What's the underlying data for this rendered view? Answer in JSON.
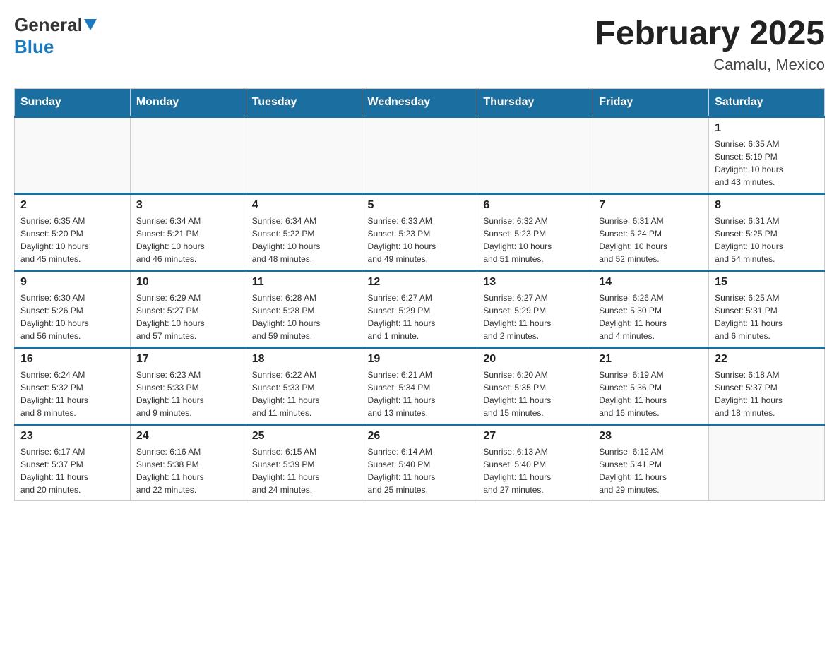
{
  "header": {
    "logo": {
      "general": "General",
      "blue": "Blue"
    },
    "title": "February 2025",
    "location": "Camalu, Mexico"
  },
  "days_of_week": [
    "Sunday",
    "Monday",
    "Tuesday",
    "Wednesday",
    "Thursday",
    "Friday",
    "Saturday"
  ],
  "weeks": [
    [
      {
        "day": "",
        "info": ""
      },
      {
        "day": "",
        "info": ""
      },
      {
        "day": "",
        "info": ""
      },
      {
        "day": "",
        "info": ""
      },
      {
        "day": "",
        "info": ""
      },
      {
        "day": "",
        "info": ""
      },
      {
        "day": "1",
        "info": "Sunrise: 6:35 AM\nSunset: 5:19 PM\nDaylight: 10 hours\nand 43 minutes."
      }
    ],
    [
      {
        "day": "2",
        "info": "Sunrise: 6:35 AM\nSunset: 5:20 PM\nDaylight: 10 hours\nand 45 minutes."
      },
      {
        "day": "3",
        "info": "Sunrise: 6:34 AM\nSunset: 5:21 PM\nDaylight: 10 hours\nand 46 minutes."
      },
      {
        "day": "4",
        "info": "Sunrise: 6:34 AM\nSunset: 5:22 PM\nDaylight: 10 hours\nand 48 minutes."
      },
      {
        "day": "5",
        "info": "Sunrise: 6:33 AM\nSunset: 5:23 PM\nDaylight: 10 hours\nand 49 minutes."
      },
      {
        "day": "6",
        "info": "Sunrise: 6:32 AM\nSunset: 5:23 PM\nDaylight: 10 hours\nand 51 minutes."
      },
      {
        "day": "7",
        "info": "Sunrise: 6:31 AM\nSunset: 5:24 PM\nDaylight: 10 hours\nand 52 minutes."
      },
      {
        "day": "8",
        "info": "Sunrise: 6:31 AM\nSunset: 5:25 PM\nDaylight: 10 hours\nand 54 minutes."
      }
    ],
    [
      {
        "day": "9",
        "info": "Sunrise: 6:30 AM\nSunset: 5:26 PM\nDaylight: 10 hours\nand 56 minutes."
      },
      {
        "day": "10",
        "info": "Sunrise: 6:29 AM\nSunset: 5:27 PM\nDaylight: 10 hours\nand 57 minutes."
      },
      {
        "day": "11",
        "info": "Sunrise: 6:28 AM\nSunset: 5:28 PM\nDaylight: 10 hours\nand 59 minutes."
      },
      {
        "day": "12",
        "info": "Sunrise: 6:27 AM\nSunset: 5:29 PM\nDaylight: 11 hours\nand 1 minute."
      },
      {
        "day": "13",
        "info": "Sunrise: 6:27 AM\nSunset: 5:29 PM\nDaylight: 11 hours\nand 2 minutes."
      },
      {
        "day": "14",
        "info": "Sunrise: 6:26 AM\nSunset: 5:30 PM\nDaylight: 11 hours\nand 4 minutes."
      },
      {
        "day": "15",
        "info": "Sunrise: 6:25 AM\nSunset: 5:31 PM\nDaylight: 11 hours\nand 6 minutes."
      }
    ],
    [
      {
        "day": "16",
        "info": "Sunrise: 6:24 AM\nSunset: 5:32 PM\nDaylight: 11 hours\nand 8 minutes."
      },
      {
        "day": "17",
        "info": "Sunrise: 6:23 AM\nSunset: 5:33 PM\nDaylight: 11 hours\nand 9 minutes."
      },
      {
        "day": "18",
        "info": "Sunrise: 6:22 AM\nSunset: 5:33 PM\nDaylight: 11 hours\nand 11 minutes."
      },
      {
        "day": "19",
        "info": "Sunrise: 6:21 AM\nSunset: 5:34 PM\nDaylight: 11 hours\nand 13 minutes."
      },
      {
        "day": "20",
        "info": "Sunrise: 6:20 AM\nSunset: 5:35 PM\nDaylight: 11 hours\nand 15 minutes."
      },
      {
        "day": "21",
        "info": "Sunrise: 6:19 AM\nSunset: 5:36 PM\nDaylight: 11 hours\nand 16 minutes."
      },
      {
        "day": "22",
        "info": "Sunrise: 6:18 AM\nSunset: 5:37 PM\nDaylight: 11 hours\nand 18 minutes."
      }
    ],
    [
      {
        "day": "23",
        "info": "Sunrise: 6:17 AM\nSunset: 5:37 PM\nDaylight: 11 hours\nand 20 minutes."
      },
      {
        "day": "24",
        "info": "Sunrise: 6:16 AM\nSunset: 5:38 PM\nDaylight: 11 hours\nand 22 minutes."
      },
      {
        "day": "25",
        "info": "Sunrise: 6:15 AM\nSunset: 5:39 PM\nDaylight: 11 hours\nand 24 minutes."
      },
      {
        "day": "26",
        "info": "Sunrise: 6:14 AM\nSunset: 5:40 PM\nDaylight: 11 hours\nand 25 minutes."
      },
      {
        "day": "27",
        "info": "Sunrise: 6:13 AM\nSunset: 5:40 PM\nDaylight: 11 hours\nand 27 minutes."
      },
      {
        "day": "28",
        "info": "Sunrise: 6:12 AM\nSunset: 5:41 PM\nDaylight: 11 hours\nand 29 minutes."
      },
      {
        "day": "",
        "info": ""
      }
    ]
  ]
}
